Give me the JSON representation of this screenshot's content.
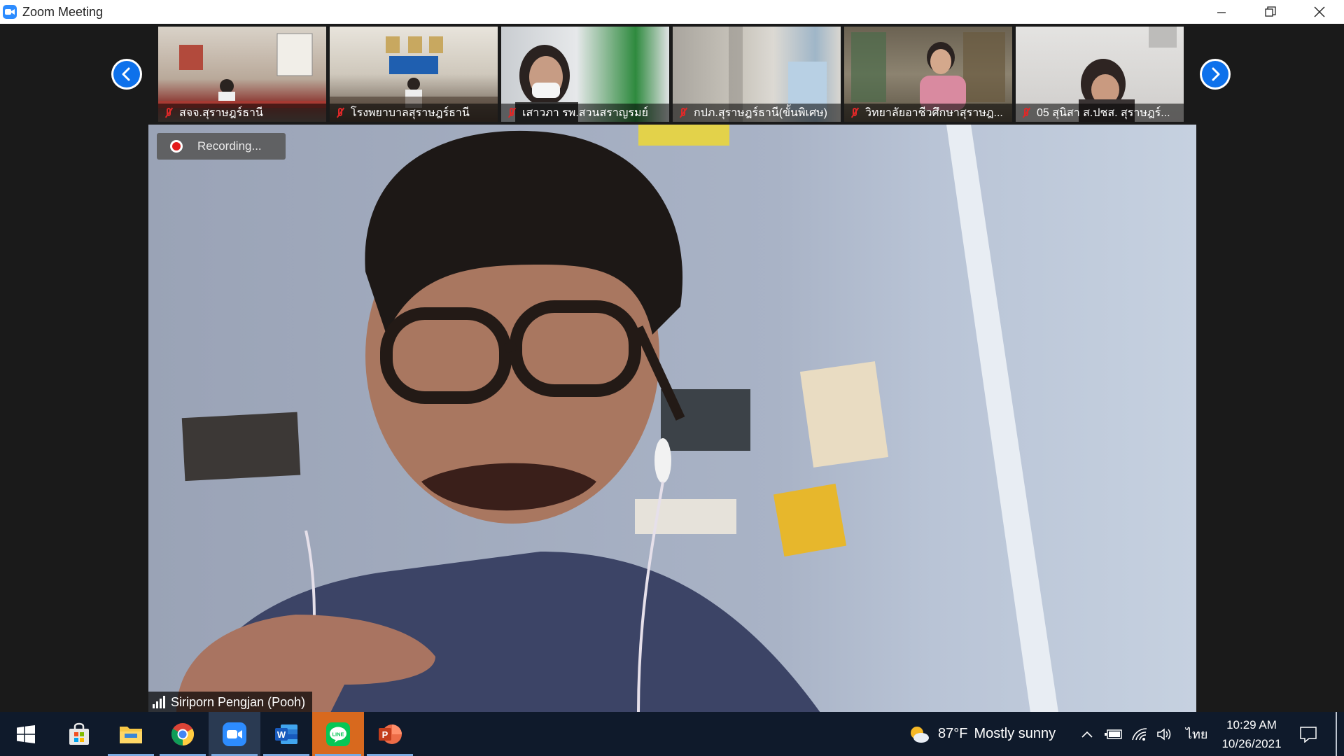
{
  "window": {
    "title": "Zoom Meeting"
  },
  "gallery": {
    "participants": [
      {
        "name": "สจจ.สุราษฎร์ธานี",
        "muted": true,
        "bg": "#b9a99a"
      },
      {
        "name": "โรงพยาบาลสุราษฎร์ธานี",
        "muted": true,
        "bg": "#9c9588"
      },
      {
        "name": "เสาวภา รพ.สวนสราญรมย์",
        "muted": true,
        "bg": "#8ca08c"
      },
      {
        "name": "กปภ.สุราษฎร์ธานี(ขั้นพิเศษ)",
        "muted": true,
        "bg": "#b8b4aa"
      },
      {
        "name": "วิทยาลัยอาชีวศึกษาสุราษฎ...",
        "muted": true,
        "bg": "#7d7462"
      },
      {
        "name": "05 สุนิสา ส.ปชส. สุราษฎร์...",
        "muted": true,
        "bg": "#c9c7c6"
      }
    ]
  },
  "main_video": {
    "recording_label": "Recording...",
    "speaker_name": "Siriporn Pengjan (Pooh)"
  },
  "taskbar": {
    "pinned": [
      "windows-start",
      "microsoft-store",
      "file-explorer",
      "chrome",
      "zoom",
      "word",
      "line",
      "powerpoint"
    ],
    "weather": {
      "temp": "87°F",
      "condition": "Mostly sunny"
    },
    "language": "ไทย",
    "time": "10:29 AM",
    "date": "10/26/2021"
  },
  "colors": {
    "zoom_blue": "#0E71EB",
    "mute_red": "#e02828",
    "taskbar_bg": "#0f1a2b"
  }
}
